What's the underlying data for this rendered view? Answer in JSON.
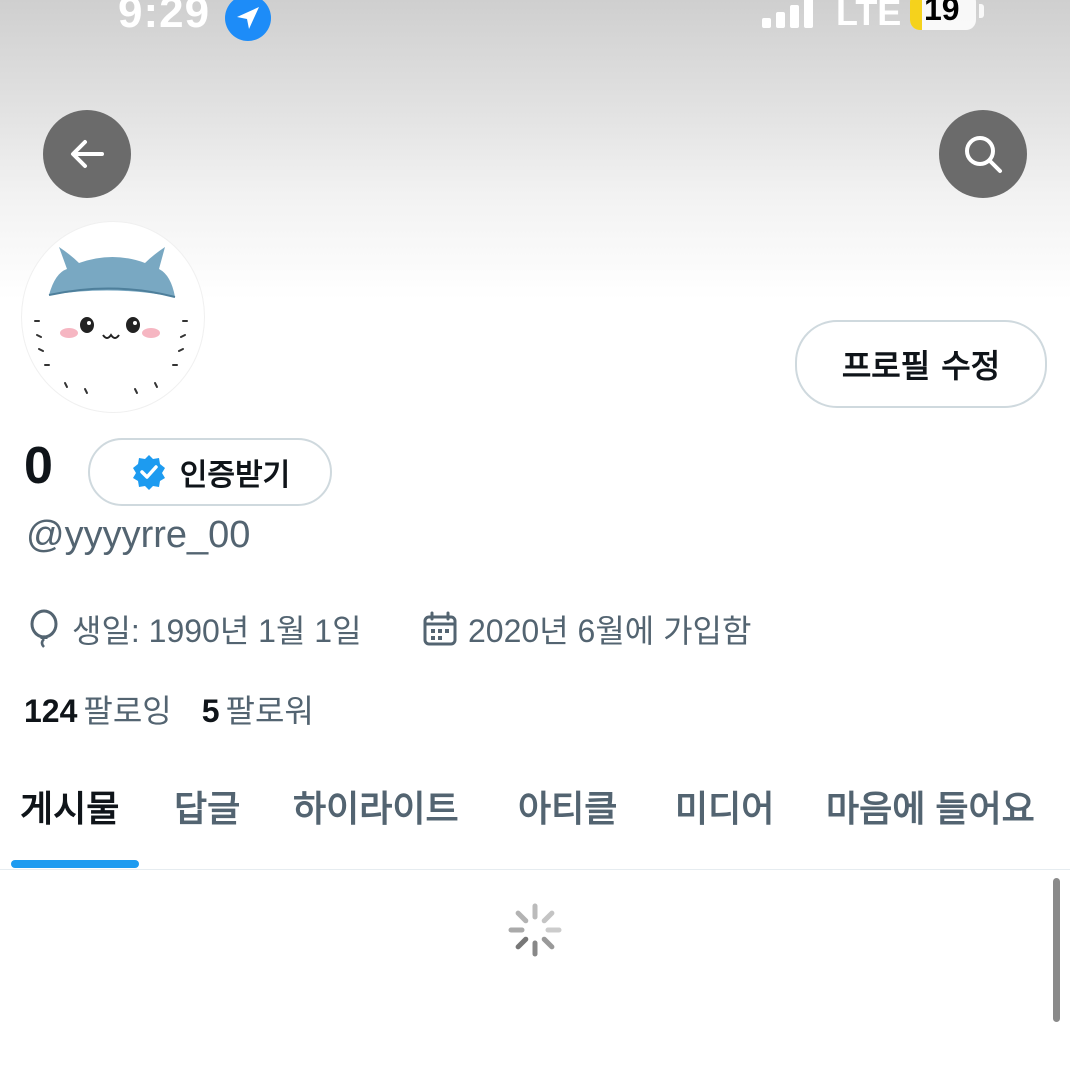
{
  "status_bar": {
    "time": "9:29",
    "network": "LTE",
    "battery": "19",
    "location_icon": "location-arrow-icon",
    "signal_icon": "cellular-signal-icon"
  },
  "header": {
    "back_icon": "arrow-left-icon",
    "search_icon": "search-icon"
  },
  "profile": {
    "display_name": "0",
    "verify_label": "인증받기",
    "verify_icon": "verified-badge-icon",
    "username": "@yyyyrre_00",
    "edit_profile_label": "프로필 수정",
    "birthday": "생일: 1990년 1월 1일",
    "birthday_icon": "balloon-icon",
    "joined": "2020년 6월에 가입함",
    "joined_icon": "calendar-icon",
    "following_count": "124",
    "following_label": "팔로잉",
    "followers_count": "5",
    "followers_label": "팔로워"
  },
  "tabs": [
    {
      "label": "게시물",
      "active": true
    },
    {
      "label": "답글",
      "active": false
    },
    {
      "label": "하이라이트",
      "active": false
    },
    {
      "label": "아티클",
      "active": false
    },
    {
      "label": "미디어",
      "active": false
    },
    {
      "label": "마음에 들어요",
      "active": false
    }
  ],
  "colors": {
    "accent": "#1d9bf0",
    "text_primary": "#0f1419",
    "text_secondary": "#536471",
    "header_button": "#6b6b6b"
  }
}
